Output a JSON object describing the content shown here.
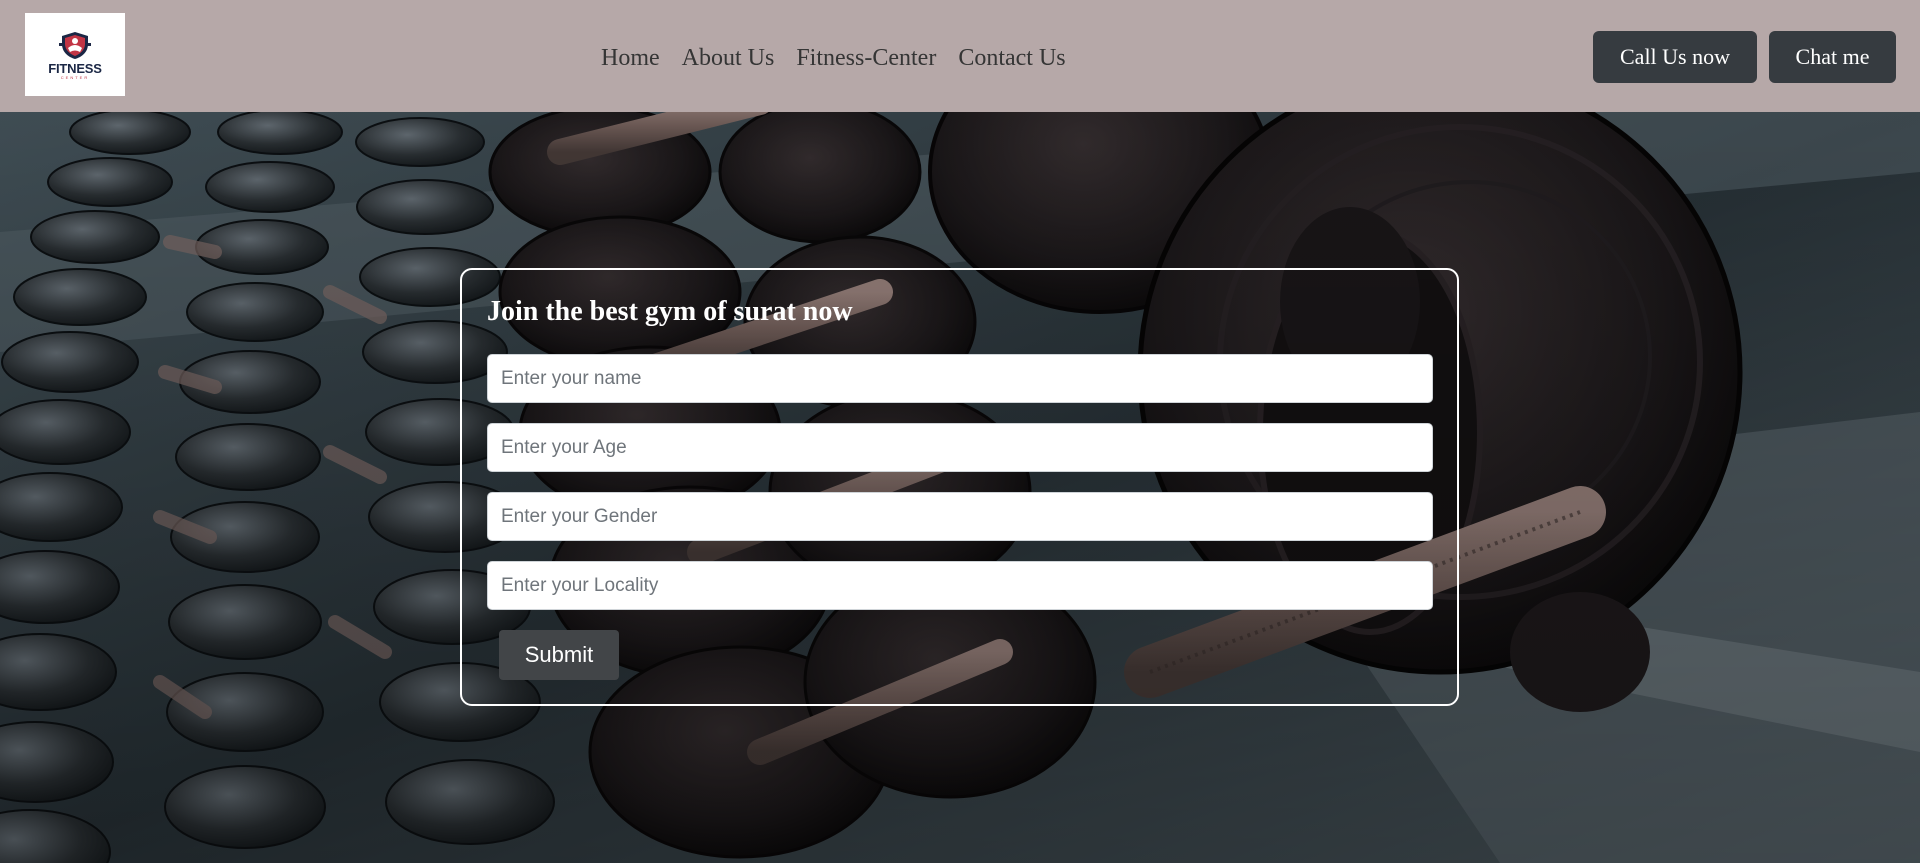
{
  "header": {
    "logo": {
      "word": "FITNESS",
      "sub": "CENTER"
    },
    "nav": [
      {
        "label": "Home"
      },
      {
        "label": "About Us"
      },
      {
        "label": "Fitness-Center"
      },
      {
        "label": "Contact Us"
      }
    ],
    "call_button": "Call Us now",
    "chat_button": "Chat me"
  },
  "form": {
    "title": "Join the best gym of surat now",
    "fields": [
      {
        "placeholder": "Enter your name",
        "value": ""
      },
      {
        "placeholder": "Enter your Age",
        "value": ""
      },
      {
        "placeholder": "Enter your Gender",
        "value": ""
      },
      {
        "placeholder": "Enter your Locality",
        "value": ""
      }
    ],
    "submit_label": "Submit"
  },
  "colors": {
    "navbar": "#b6a8a8",
    "button_dark": "#363b40",
    "submit": "#424548",
    "logo_navy": "#1b2745",
    "logo_red": "#c23545"
  },
  "background": "gym dumbbell rack photo"
}
